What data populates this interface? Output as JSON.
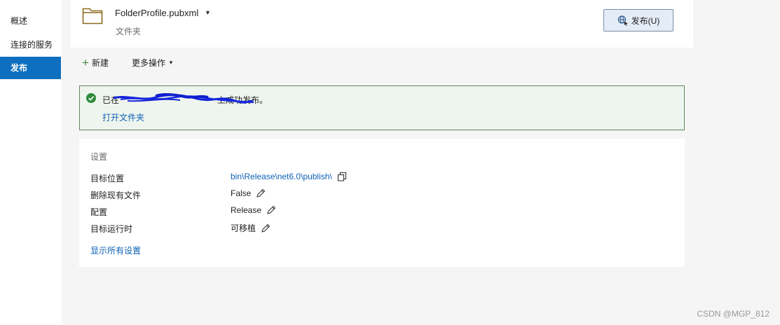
{
  "sidebar": {
    "items": [
      {
        "label": "概述"
      },
      {
        "label": "连接的服务"
      },
      {
        "label": "发布"
      }
    ]
  },
  "profile": {
    "name": "FolderProfile.pubxml",
    "type": "文件夹",
    "publish_label": "发布(U)"
  },
  "toolbar": {
    "new_label": "新建",
    "more_label": "更多操作"
  },
  "success": {
    "prefix": "已在",
    "suffix": "上成功发布。",
    "open_folder": "打开文件夹"
  },
  "settings": {
    "title": "设置",
    "rows": [
      {
        "label": "目标位置",
        "value": "bin\\Release\\net6.0\\publish\\"
      },
      {
        "label": "删除现有文件",
        "value": "False"
      },
      {
        "label": "配置",
        "value": "Release"
      },
      {
        "label": "目标运行时",
        "value": "可移植"
      }
    ],
    "show_all": "显示所有设置"
  },
  "watermark": "CSDN @MGP_812",
  "colors": {
    "accent": "#0e6fc0",
    "link": "#0e62b5",
    "success_border": "#5c8a5c",
    "success_bg": "#eef5ee"
  },
  "icons": [
    "folder-icon",
    "chevron-down-icon",
    "globe-publish-icon",
    "plus-icon",
    "check-circle-icon",
    "copy-icon",
    "pencil-icon"
  ]
}
